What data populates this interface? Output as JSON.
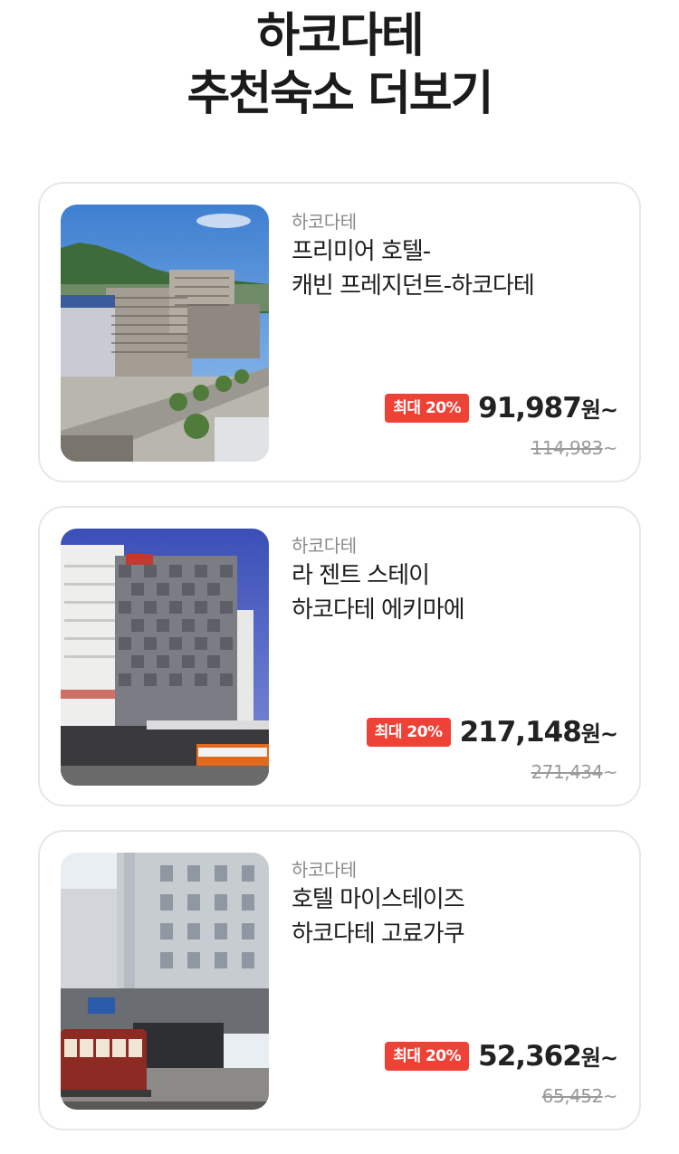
{
  "header": {
    "title_line1": "하코다테",
    "title_line2": "추천숙소 더보기"
  },
  "hotels": [
    {
      "city": "하코다테",
      "name_line1": "프리미어 호텔-",
      "name_line2": "캐빈 프레지던트-하코다테",
      "discount_badge": "최대 20%",
      "price": "91,987",
      "price_suffix": "원~",
      "original_price": "114,983",
      "original_suffix": "~"
    },
    {
      "city": "하코다테",
      "name_line1": "라 젠트 스테이",
      "name_line2": "하코다테 에키마에",
      "discount_badge": "최대 20%",
      "price": "217,148",
      "price_suffix": "원~",
      "original_price": "271,434",
      "original_suffix": "~"
    },
    {
      "city": "하코다테",
      "name_line1": "호텔 마이스테이즈",
      "name_line2": "하코다테 고료가쿠",
      "discount_badge": "최대 20%",
      "price": "52,362",
      "price_suffix": "원~",
      "original_price": "65,452",
      "original_suffix": "~"
    }
  ],
  "colors": {
    "badge_bg": "#ef4236",
    "card_border": "#e7e7e7",
    "muted_text": "#8a8a8a"
  }
}
